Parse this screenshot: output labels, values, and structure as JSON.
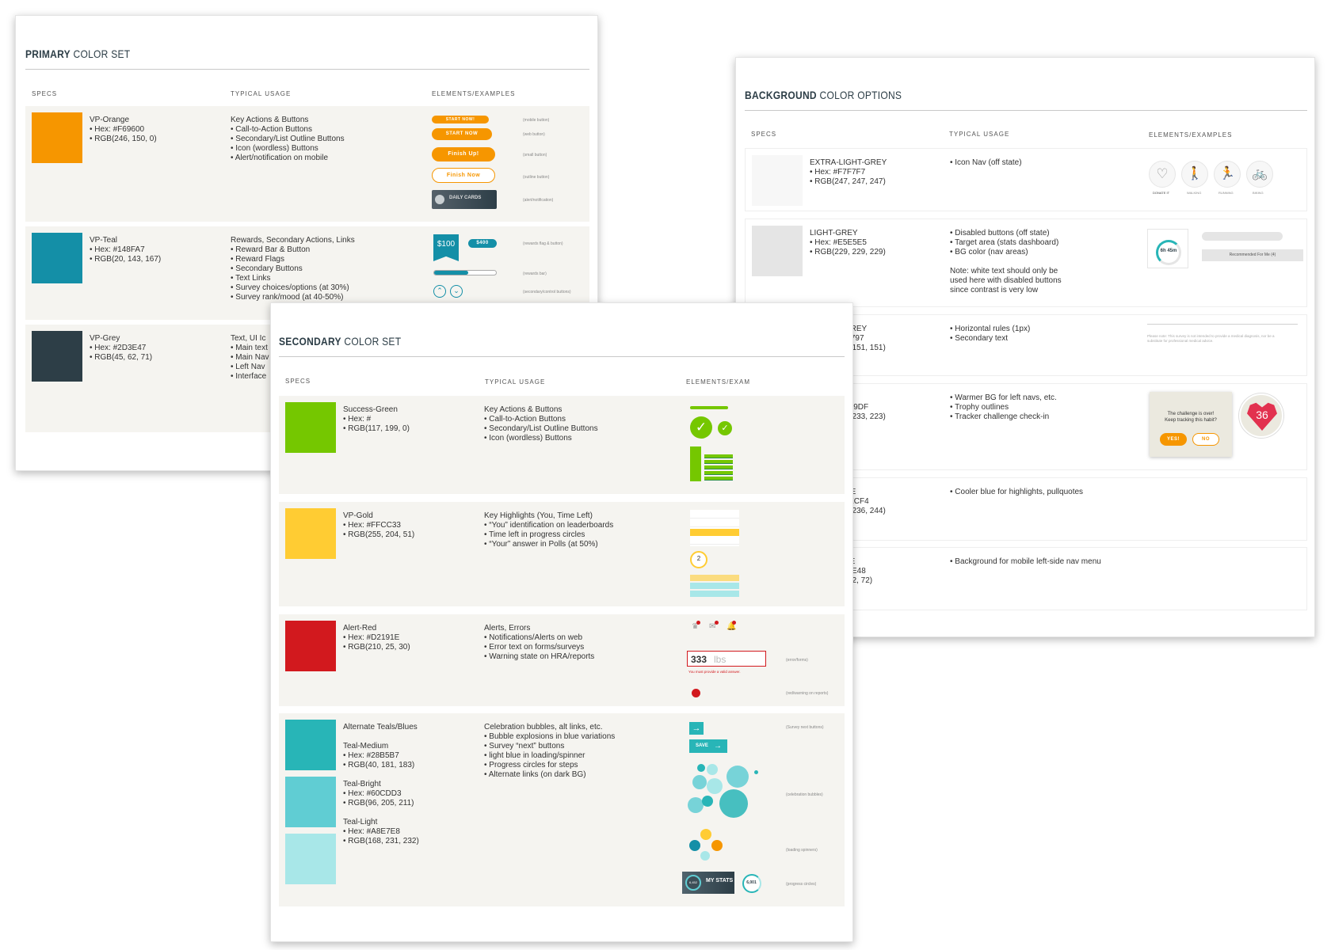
{
  "primary": {
    "title_bold": "PRIMARY",
    "title_light": "COLOR SET",
    "headers": {
      "specs": "SPECS",
      "usage": "TYPICAL USAGE",
      "examples": "ELEMENTS/EXAMPLES"
    },
    "rows": [
      {
        "color": "#F69600",
        "spec": "VP-Orange\n• Hex: #F69600\n• RGB(246, 150, 0)",
        "usage": "Key Actions & Buttons\n• Call-to-Action Buttons\n• Secondary/List Outline Buttons\n• Icon (wordless) Buttons\n• Alert/notification on mobile"
      },
      {
        "color": "#148FA7",
        "spec": "VP-Teal\n• Hex: #148FA7\n• RGB(20, 143, 167)",
        "usage": "Rewards, Secondary Actions, Links\n• Reward Bar & Button\n• Reward Flags\n• Secondary Buttons\n• Text Links\n• Survey choices/options (at 30%)\n• Survey rank/mood (at 40-50%)"
      },
      {
        "color": "#2D3E47",
        "spec": "VP-Grey\n• Hex: #2D3E47\n• RGB(45, 62, 71)",
        "usage": "Text, UI Ic\n• Main text\n• Main Nav\n• Left Nav\n• Interface"
      }
    ],
    "examples": {
      "start_now_mobile": "START NOW!",
      "start_now_web": "START NOW",
      "finish_up": "Finish Up!",
      "finish_now": "Finish Now",
      "daily_cards": "DAILY CARDS",
      "note_mobile": "(mobile button)",
      "note_web": "(web button)",
      "note_small": "(small button)",
      "note_outline": "(outline button)",
      "note_alert": "(alert/notification)",
      "reward_flag": "$100",
      "reward_button": "$400",
      "note_rewards_flag": "(rewards flag & button)",
      "note_rewards_bar": "(rewards bar)",
      "note_secondary": "(secondary/control buttons)"
    }
  },
  "secondary": {
    "title_bold": "SECONDARY",
    "title_light": "COLOR SET",
    "headers": {
      "specs": "SPECS",
      "usage": "TYPICAL USAGE",
      "examples": "ELEMENTS/EXAM"
    },
    "rows": [
      {
        "color": "#75C700",
        "spec": "Success-Green\n• Hex: #\n• RGB(117, 199, 0)",
        "usage": "Key Actions & Buttons\n• Call-to-Action Buttons\n• Secondary/List Outline Buttons\n• Icon (wordless) Buttons"
      },
      {
        "color": "#FFCC33",
        "spec": "VP-Gold\n• Hex: #FFCC33\n• RGB(255, 204, 51)",
        "usage": "Key Highlights (You, Time Left)\n• “You” identification on leaderboards\n• Time left in progress circles\n• “Your” answer in Polls (at 50%)"
      },
      {
        "color": "#D2191E",
        "spec": "Alert-Red\n• Hex: #D2191E\n• RGB(210, 25, 30)",
        "usage": "Alerts, Errors\n• Notifications/Alerts on web\n• Error text on forms/surveys\n• Warning state on HRA/reports"
      },
      {
        "spec": "Alternate Teals/Blues\n\nTeal-Medium\n• Hex: #28B5B7\n• RGB(40, 181, 183)\n\nTeal-Bright\n• Hex: #60CDD3\n• RGB(96, 205, 211)\n\nTeal-Light\n• Hex: #A8E7E8\n• RGB(168, 231, 232)",
        "usage": "Celebration bubbles, alt links, etc.\n• Bubble explosions in blue variations\n• Survey “next” buttons\n• light blue in loading/spinner\n• Progress circles for steps\n• Alternate links (on dark BG)"
      }
    ],
    "teal_colors": [
      "#28B5B7",
      "#60CDD3",
      "#A8E7E8"
    ],
    "examples": {
      "progress_value": "2",
      "weight_value": "333",
      "weight_unit": "lbs",
      "error_text": "You must provide a valid answer.",
      "note_error_forms": "(error/forms)",
      "note_warning": "(red/warning on reports)",
      "save_label": "SAVE",
      "note_survey_next": "(Survey next buttons)",
      "note_celebration": "(celebration bubbles)",
      "note_loading": "(loading spinners)",
      "my_stats": "MY STATS",
      "my_stats_value": "6,452",
      "steps_value": "6,001",
      "note_progress": "(progress circles)"
    }
  },
  "background": {
    "title_bold": "BACKGROUND",
    "title_light": "COLOR OPTIONS",
    "headers": {
      "specs": "SPECS",
      "usage": "TYPICAL USAGE",
      "examples": "ELEMENTS/EXAMPLES"
    },
    "rows": [
      {
        "color": "#F7F7F7",
        "spec": "EXTRA-LIGHT-GREY\n• Hex: #F7F7F7\n• RGB(247, 247, 247)",
        "usage": "• Icon Nav (off state)"
      },
      {
        "color": "#E5E5E5",
        "spec": "LIGHT-GREY\n• Hex: #E5E5E5\n• RGB(229, 229, 229)",
        "usage": "• Disabled buttons (off state)\n• Target area (stats dashboard)\n• BG color (nav areas)\n\nNote: white text should only be\nused here with disabled buttons\nsince contrast is very low"
      },
      {
        "color": "#979797",
        "spec": "MEDIUM-GREY\n• Hex: #979797\n• RGB(151, 151, 151)",
        "usage": "• Horizontal rules (1px)\n• Secondary text"
      },
      {
        "color": "#EBE9DF",
        "spec": "LIGHT-TAN\n• Hex: #EBE9DF\n• RGB(235, 233, 223)",
        "usage": "• Warmer BG for left navs, etc.\n• Trophy outlines\n• Tracker challenge check-in"
      },
      {
        "color": "#CAECF4",
        "spec": "LIGHT-BLUE\n• Hex: #CAECF4\n• RGB(202, 236, 244)",
        "usage": "• Cooler blue for highlights, pullquotes"
      },
      {
        "color": "#2E3E48",
        "spec": "DARK-BLUE\n• Hex: #2E3E48\n• RGB(46, 62, 72)",
        "usage": "• Background for mobile left-side nav menu"
      }
    ],
    "examples": {
      "icon_labels": [
        "DONATE IT",
        "WALKING",
        "RUNNING",
        "BIKING"
      ],
      "sleep_value": "6h 45m",
      "recommended": "Recommended For Me (4)",
      "medical_note": "Please note: This survey is not intended to provide a medical diagnosis, nor be a substitute for professional medical advice.",
      "challenge_text": "The challenge is over!\nKeep tracking this habit?",
      "yes_label": "YES!",
      "no_label": "NO",
      "trophy_value": "36"
    }
  }
}
